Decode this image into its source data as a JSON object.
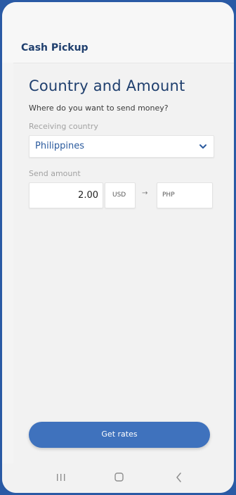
{
  "header": {
    "title": "Cash Pickup"
  },
  "main": {
    "title": "Country and Amount",
    "subtitle": "Where do you want to send money?",
    "receiving_country": {
      "label": "Receiving country",
      "value": "Philippines"
    },
    "send_amount": {
      "label": "Send amount",
      "value": "2.00",
      "from_currency": "USD",
      "to_currency": "PHP"
    },
    "cta_label": "Get rates"
  },
  "nav": {
    "recent_icon": "recent-apps-icon",
    "home_icon": "home-icon",
    "back_icon": "back-icon"
  },
  "colors": {
    "outer_frame": "#2a5aa5",
    "brand_text": "#1f3f6e",
    "accent": "#3f72bd",
    "link_text": "#2b5b9e"
  }
}
